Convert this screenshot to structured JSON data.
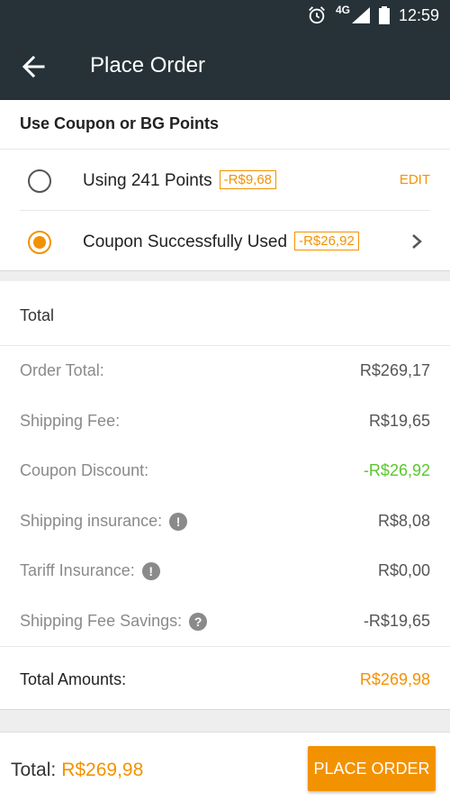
{
  "status_bar": {
    "time": "12:59",
    "network": "4G",
    "icons": [
      "alarm-icon",
      "signal-icon",
      "battery-icon"
    ]
  },
  "app_bar": {
    "title": "Place Order",
    "back_icon": "arrow-left-icon"
  },
  "coupon_section": {
    "title": "Use Coupon or BG Points",
    "options": [
      {
        "label": "Using 241 Points",
        "badge": "-R$9,68",
        "action": "EDIT",
        "selected": false
      },
      {
        "label": "Coupon Successfully Used",
        "badge": "-R$26,92",
        "action_icon": "chevron-right-icon",
        "selected": true
      }
    ]
  },
  "total_section": {
    "title": "Total",
    "lines": {
      "order_total": {
        "label": "Order Total:",
        "value": "R$269,17"
      },
      "shipping_fee": {
        "label": "Shipping Fee:",
        "value": "R$19,65"
      },
      "coupon_discount": {
        "label": "Coupon Discount:",
        "value": "-R$26,92"
      },
      "shipping_insurance": {
        "label": "Shipping insurance:",
        "value": "R$8,08",
        "icon": "!"
      },
      "tariff_insurance": {
        "label": "Tariff Insurance:",
        "value": "R$0,00",
        "icon": "!"
      },
      "shipping_fee_savings": {
        "label": "Shipping Fee Savings:",
        "value": "-R$19,65",
        "icon": "?"
      }
    },
    "total_amounts": {
      "label": "Total Amounts:",
      "value": "R$269,98"
    }
  },
  "bottom_bar": {
    "total_label": "Total:",
    "total_value": "R$269,98",
    "button_label": "PLACE ORDER"
  },
  "colors": {
    "bar": "#263238",
    "accent": "#f39200",
    "green": "#5ac72d"
  }
}
